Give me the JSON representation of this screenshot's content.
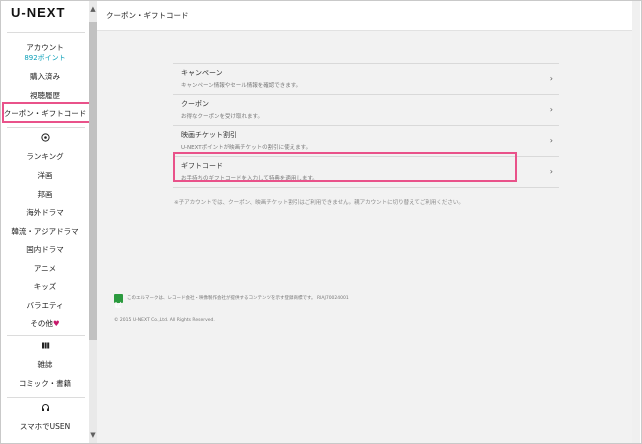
{
  "sidebar": {
    "logo": "U-NEXT",
    "account_label": "アカウント",
    "points": "892ポイント",
    "purchased": "購入済み",
    "history": "視聴履歴",
    "coupon": "クーポン・ギフトコード",
    "video_items": [
      "ランキング",
      "洋画",
      "邦画",
      "海外ドラマ",
      "韓流・アジアドラマ",
      "国内ドラマ",
      "アニメ",
      "キッズ",
      "バラエティ",
      "その他"
    ],
    "book_items": [
      "雑誌",
      "コミック・書籍"
    ],
    "music_item": "スマホでUSEN"
  },
  "header": {
    "title": "クーポン・ギフトコード"
  },
  "list": [
    {
      "title": "キャンペーン",
      "desc": "キャンペーン情報やセール情報を確認できます。"
    },
    {
      "title": "クーポン",
      "desc": "お得なクーポンを受け取れます。"
    },
    {
      "title": "映画チケット割引",
      "desc": "U-NEXTポイントが映画チケットの割引に使えます。"
    },
    {
      "title": "ギフトコード",
      "desc": "お手持ちのギフトコードを入力して特典を適用します。"
    }
  ],
  "note": "※子アカウントでは、クーポン、映画チケット割引はご利用できません。親アカウントに切り替えてご利用ください。",
  "footer": {
    "lmark_text": "このエルマークは、レコード会社・映像製作会社が提供するコンテンツを示す登録商標です。 RIAJ70024001",
    "copyright": "© 2015 U-NEXT Co.,Ltd. All Rights Reserved."
  },
  "icons": {
    "chevron": "›",
    "heart": "♥"
  },
  "colors": {
    "highlight": "#e9528a",
    "points": "#0a9fb8",
    "heart": "#c7196b",
    "lmark": "#2b9a3e"
  }
}
